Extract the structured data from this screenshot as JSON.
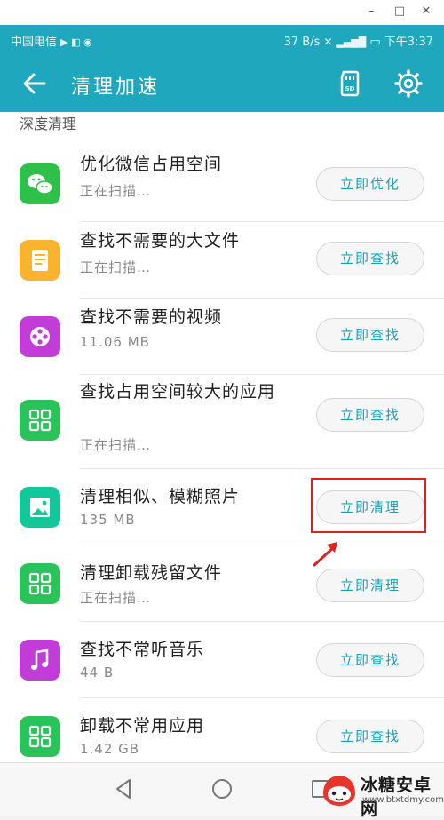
{
  "status_bar": {
    "carrier": "中国电信",
    "speed": "37 B/s",
    "time": "下午3:37"
  },
  "toolbar": {
    "title": "清理加速"
  },
  "section_label": "深度清理",
  "items": [
    {
      "title": "优化微信占用空间",
      "subtitle": "正在扫描…",
      "button": "立即优化",
      "icon": "wechat-icon",
      "color": "#2dc14a"
    },
    {
      "title": "查找不需要的大文件",
      "subtitle": "正在扫描…",
      "button": "立即查找",
      "icon": "document-icon",
      "color": "#f7b42c"
    },
    {
      "title": "查找不需要的视频",
      "subtitle": "11.06 MB",
      "button": "立即查找",
      "icon": "film-reel-icon",
      "color": "#c23dd8"
    },
    {
      "title": "查找占用空间较大的应用",
      "subtitle": "正在扫描…",
      "button": "立即查找",
      "icon": "app-grid-icon",
      "color": "#29c35a"
    },
    {
      "title": "清理相似、模糊照片",
      "subtitle": "135 MB",
      "button": "立即清理",
      "icon": "photo-icon",
      "color": "#12c89a"
    },
    {
      "title": "清理卸载残留文件",
      "subtitle": "正在扫描…",
      "button": "立即清理",
      "icon": "app-grid-icon",
      "color": "#29c35a"
    },
    {
      "title": "查找不常听音乐",
      "subtitle": "44 B",
      "button": "立即查找",
      "icon": "music-note-icon",
      "color": "#c23dd8"
    },
    {
      "title": "卸载不常用应用",
      "subtitle": "1.42 GB",
      "button": "立即查找",
      "icon": "app-grid-icon",
      "color": "#29c35a"
    }
  ],
  "watermark": {
    "name": "冰糖安卓网",
    "url": "www.btxtdmy.com"
  }
}
